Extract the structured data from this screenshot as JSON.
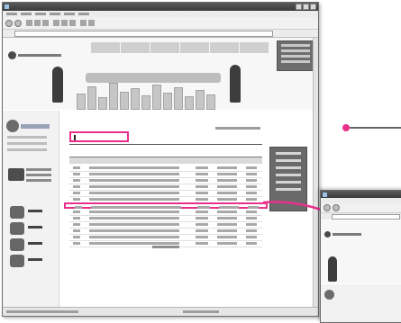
{
  "note": ". . .",
  "browser": {
    "title": ""
  },
  "board": {
    "title": ""
  },
  "inset": {
    "title": ""
  },
  "colors": {
    "highlight": "#e8308b",
    "window_chrome": "#3a3a3a"
  },
  "icons": [
    "browser-icon",
    "back-icon",
    "forward-icon",
    "home-icon",
    "search-icon",
    "logo-icon",
    "phone-icon",
    "board-icon"
  ]
}
